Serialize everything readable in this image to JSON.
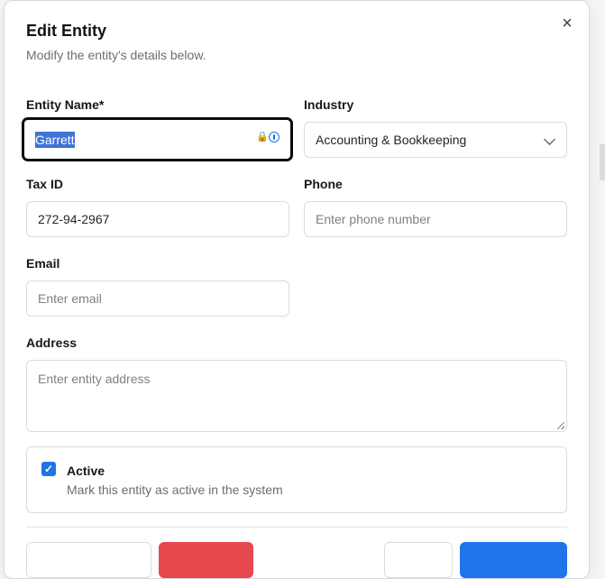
{
  "dialog": {
    "title": "Edit Entity",
    "subtitle": "Modify the entity's details below.",
    "close_icon": "×"
  },
  "form": {
    "entity_name": {
      "label": "Entity Name*",
      "value": "Garrett"
    },
    "industry": {
      "label": "Industry",
      "value": "Accounting & Bookkeeping"
    },
    "tax_id": {
      "label": "Tax ID",
      "value": "272-94-2967"
    },
    "phone": {
      "label": "Phone",
      "placeholder": "Enter phone number"
    },
    "email": {
      "label": "Email",
      "placeholder": "Enter email"
    },
    "address": {
      "label": "Address",
      "placeholder": "Enter entity address"
    },
    "active": {
      "label": "Active",
      "description": "Mark this entity as active in the system",
      "checked": true,
      "check_glyph": "✓"
    }
  },
  "icons": {
    "lock": "🔒"
  },
  "colors": {
    "primary": "#1e74e8",
    "danger": "#e5484d",
    "selection": "#3f73d6"
  }
}
